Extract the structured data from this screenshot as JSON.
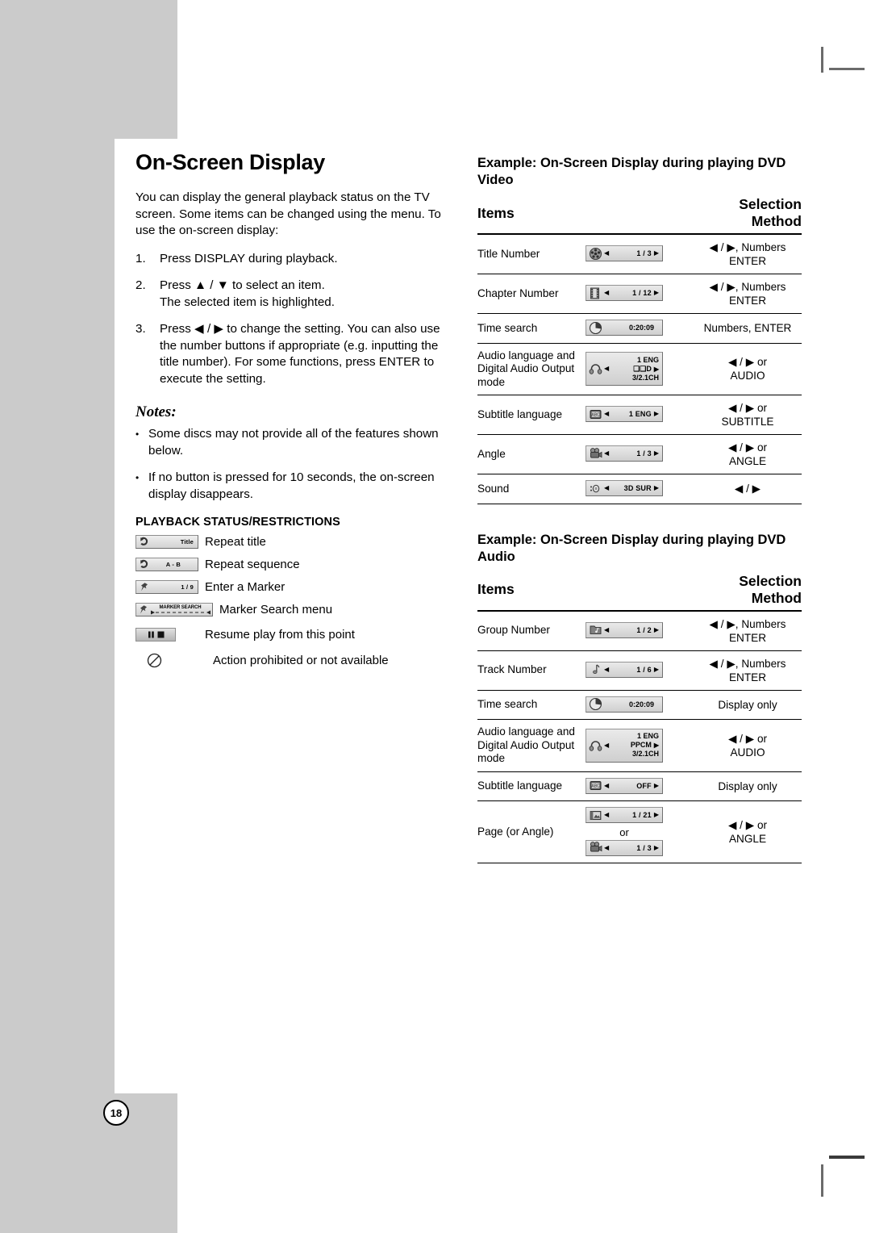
{
  "page": {
    "number": "18"
  },
  "left": {
    "title": "On-Screen Display",
    "intro": "You can display the general playback status on the TV screen. Some items can be changed using the menu. To use the on-screen display:",
    "steps": [
      {
        "num": "1.",
        "text": "Press DISPLAY during playback."
      },
      {
        "num": "2.",
        "text": "Press ▲ / ▼ to select an item.\nThe selected item is highlighted."
      },
      {
        "num": "3.",
        "text": "Press ◀ / ▶ to change the setting. You can also use the number buttons if appropriate (e.g. inputting the title number). For some functions, press ENTER to execute the setting."
      }
    ],
    "notes_heading": "Notes:",
    "notes": [
      "Some discs may not provide all of the features shown below.",
      "If no button is pressed for 10 seconds, the on-screen display disappears."
    ],
    "playback_heading": "PLAYBACK STATUS/RESTRICTIONS",
    "playback_items": [
      {
        "icon": "repeat-title-icon",
        "badge": "Title",
        "label": "Repeat title"
      },
      {
        "icon": "repeat-sequence-icon",
        "badge": "A - B",
        "label": "Repeat sequence"
      },
      {
        "icon": "marker-icon",
        "badge": "1 / 9",
        "label": "Enter a Marker"
      },
      {
        "icon": "marker-search-icon",
        "badge": "MARKER SEARCH",
        "label": "Marker Search menu"
      },
      {
        "icon": "resume-icon",
        "badge": "",
        "label": "Resume play from this point"
      },
      {
        "icon": "prohibited-icon",
        "badge": "",
        "label": "Action prohibited or not available"
      }
    ]
  },
  "video_table": {
    "heading": "Example: On-Screen Display during playing DVD Video",
    "col_items": "Items",
    "col_selection": "Selection Method",
    "rows": [
      {
        "item": "Title Number",
        "icon": "title-number-icon",
        "value": "1 / 3",
        "selection": "◀ / ▶, Numbers\nENTER"
      },
      {
        "item": "Chapter Number",
        "icon": "chapter-number-icon",
        "value": "1 / 12",
        "selection": "◀ / ▶, Numbers\nENTER"
      },
      {
        "item": "Time search",
        "icon": "time-search-icon",
        "value": "0:20:09",
        "selection": "Numbers, ENTER"
      },
      {
        "item": "Audio language and Digital Audio Output mode",
        "icon": "audio-language-icon",
        "value_line1": "1 ENG",
        "value_line2": "❑❑D",
        "value_line3": "3/2.1CH",
        "selection": "◀ / ▶ or\nAUDIO"
      },
      {
        "item": "Subtitle language",
        "icon": "subtitle-icon",
        "value": "1 ENG",
        "selection": "◀ / ▶ or\nSUBTITLE"
      },
      {
        "item": "Angle",
        "icon": "angle-icon",
        "value": "1 / 3",
        "selection": "◀ / ▶ or\nANGLE"
      },
      {
        "item": "Sound",
        "icon": "sound-icon",
        "value": "3D SUR",
        "selection": "◀ / ▶"
      }
    ]
  },
  "audio_table": {
    "heading": "Example: On-Screen Display during playing DVD Audio",
    "col_items": "Items",
    "col_selection": "Selection Method",
    "rows": [
      {
        "item": "Group Number",
        "icon": "group-number-icon",
        "value": "1 / 2",
        "selection": "◀ / ▶, Numbers\nENTER"
      },
      {
        "item": "Track Number",
        "icon": "track-number-icon",
        "value": "1 / 6",
        "selection": "◀ / ▶, Numbers\nENTER"
      },
      {
        "item": "Time search",
        "icon": "time-search-icon",
        "value": "0:20:09",
        "selection": "Display only"
      },
      {
        "item": "Audio language and Digital Audio Output mode",
        "icon": "audio-language-icon",
        "value_line1": "1 ENG",
        "value_line2": "PPCM",
        "value_line3": "3/2.1CH",
        "selection": "◀ / ▶ or\nAUDIO"
      },
      {
        "item": "Subtitle language",
        "icon": "subtitle-icon",
        "value": "OFF",
        "selection": "Display only"
      },
      {
        "item": "Page (or Angle)",
        "icon": "page-icon",
        "value": "1 / 21",
        "or_text": "or",
        "icon2": "angle-icon",
        "value2": "1 / 3",
        "selection": "◀ / ▶ or\nANGLE"
      }
    ]
  },
  "colors": {
    "gray_band": "#cbcbcb",
    "osd_bg": "#d8d8d8",
    "text": "#000000"
  }
}
